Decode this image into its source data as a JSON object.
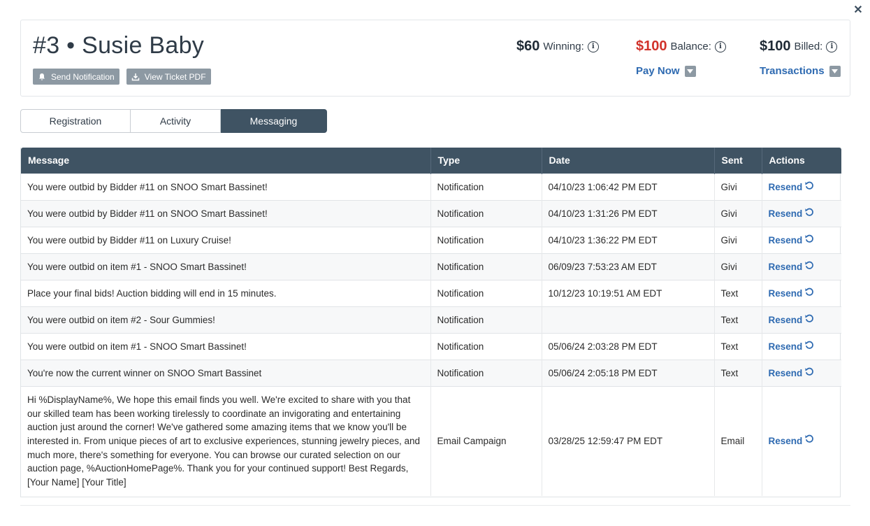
{
  "header": {
    "title": "#3 • Susie Baby",
    "buttons": {
      "send_notification": "Send Notification",
      "view_ticket_pdf": "View Ticket PDF"
    },
    "stats": {
      "winning": {
        "amount": "$60",
        "label": "Winning:"
      },
      "balance": {
        "amount": "$100",
        "label": "Balance:"
      },
      "billed": {
        "amount": "$100",
        "label": "Billed:"
      }
    },
    "links": {
      "pay_now": "Pay Now",
      "transactions": "Transactions"
    }
  },
  "tabs": [
    {
      "label": "Registration",
      "active": false
    },
    {
      "label": "Activity",
      "active": false
    },
    {
      "label": "Messaging",
      "active": true
    }
  ],
  "table": {
    "columns": [
      "Message",
      "Type",
      "Date",
      "Sent",
      "Actions"
    ],
    "action_label": "Resend",
    "rows": [
      {
        "message": "You were outbid by Bidder #11 on SNOO Smart Bassinet!",
        "type": "Notification",
        "date": "04/10/23 1:06:42 PM EDT",
        "sent": "Givi"
      },
      {
        "message": "You were outbid by Bidder #11 on SNOO Smart Bassinet!",
        "type": "Notification",
        "date": "04/10/23 1:31:26 PM EDT",
        "sent": "Givi"
      },
      {
        "message": "You were outbid by Bidder #11 on Luxury Cruise!",
        "type": "Notification",
        "date": "04/10/23 1:36:22 PM EDT",
        "sent": "Givi"
      },
      {
        "message": "You were outbid on item #1 - SNOO Smart Bassinet!",
        "type": "Notification",
        "date": "06/09/23 7:53:23 AM EDT",
        "sent": "Givi"
      },
      {
        "message": "Place your final bids! Auction bidding will end in 15 minutes.",
        "type": "Notification",
        "date": "10/12/23 10:19:51 AM EDT",
        "sent": "Text"
      },
      {
        "message": "You were outbid on item #2 - Sour Gummies!",
        "type": "Notification",
        "date": "",
        "sent": "Text"
      },
      {
        "message": "You were outbid on item #1 - SNOO Smart Bassinet!",
        "type": "Notification",
        "date": "05/06/24 2:03:28 PM EDT",
        "sent": "Text"
      },
      {
        "message": "You're now the current winner on SNOO Smart Bassinet",
        "type": "Notification",
        "date": "05/06/24 2:05:18 PM EDT",
        "sent": "Text"
      },
      {
        "message": "Hi %DisplayName%, We hope this email finds you well. We're excited to share with you that our skilled team has been working tirelessly to coordinate an invigorating and entertaining auction just around the corner! We've gathered some amazing items that we know you'll be interested in. From unique pieces of art to exclusive experiences, stunning jewelry pieces, and much more, there's something for everyone. You can browse our curated selection on our auction page, %AuctionHomePage%. Thank you for your continued support! Best Regards, [Your Name] [Your Title]",
        "type": "Email Campaign",
        "date": "03/28/25 12:59:47 PM EDT",
        "sent": "Email"
      }
    ]
  },
  "colors": {
    "primary_dark": "#3f5363",
    "link_blue": "#2e6ab1",
    "balance_red": "#d1322a",
    "button_gray": "#8d99a3"
  },
  "icons": {
    "close": "close-icon",
    "send_notification": "bell-icon",
    "view_ticket_pdf": "download-icon",
    "info": "info-icon",
    "dropdown": "chevron-down-icon",
    "resend": "resend-icon"
  }
}
